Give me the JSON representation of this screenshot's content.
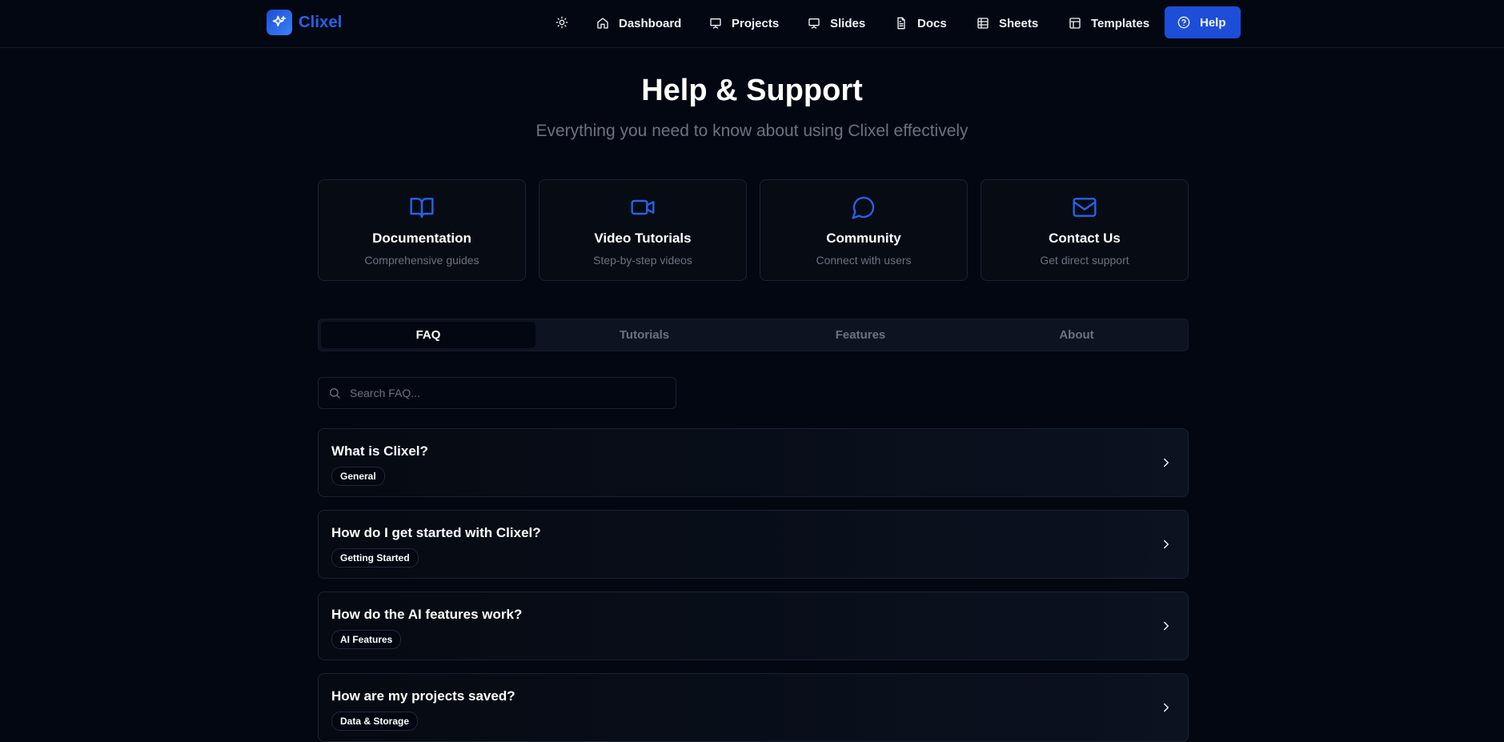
{
  "app": {
    "name": "Clixel",
    "brand_color": "#2563eb"
  },
  "nav": {
    "items": [
      {
        "label": "Dashboard",
        "icon": "home-icon"
      },
      {
        "label": "Projects",
        "icon": "presentation-icon"
      },
      {
        "label": "Slides",
        "icon": "presentation-icon"
      },
      {
        "label": "Docs",
        "icon": "file-text-icon"
      },
      {
        "label": "Sheets",
        "icon": "table-icon"
      },
      {
        "label": "Templates",
        "icon": "layout-icon"
      },
      {
        "label": "Help",
        "icon": "help-circle-icon",
        "active": true
      }
    ],
    "theme_icon": "sun-icon"
  },
  "header": {
    "title": "Help & Support",
    "subtitle": "Everything you need to know about using Clixel effectively"
  },
  "cards": [
    {
      "title": "Documentation",
      "desc": "Comprehensive guides",
      "icon": "book-open-icon"
    },
    {
      "title": "Video Tutorials",
      "desc": "Step-by-step videos",
      "icon": "video-icon"
    },
    {
      "title": "Community",
      "desc": "Connect with users",
      "icon": "message-circle-icon"
    },
    {
      "title": "Contact Us",
      "desc": "Get direct support",
      "icon": "mail-icon"
    }
  ],
  "tabs": [
    {
      "label": "FAQ",
      "active": true
    },
    {
      "label": "Tutorials",
      "active": false
    },
    {
      "label": "Features",
      "active": false
    },
    {
      "label": "About",
      "active": false
    }
  ],
  "search": {
    "placeholder": "Search FAQ...",
    "value": ""
  },
  "faq": [
    {
      "question": "What is Clixel?",
      "tag": "General"
    },
    {
      "question": "How do I get started with Clixel?",
      "tag": "Getting Started"
    },
    {
      "question": "How do the AI features work?",
      "tag": "AI Features"
    },
    {
      "question": "How are my projects saved?",
      "tag": "Data & Storage"
    }
  ]
}
